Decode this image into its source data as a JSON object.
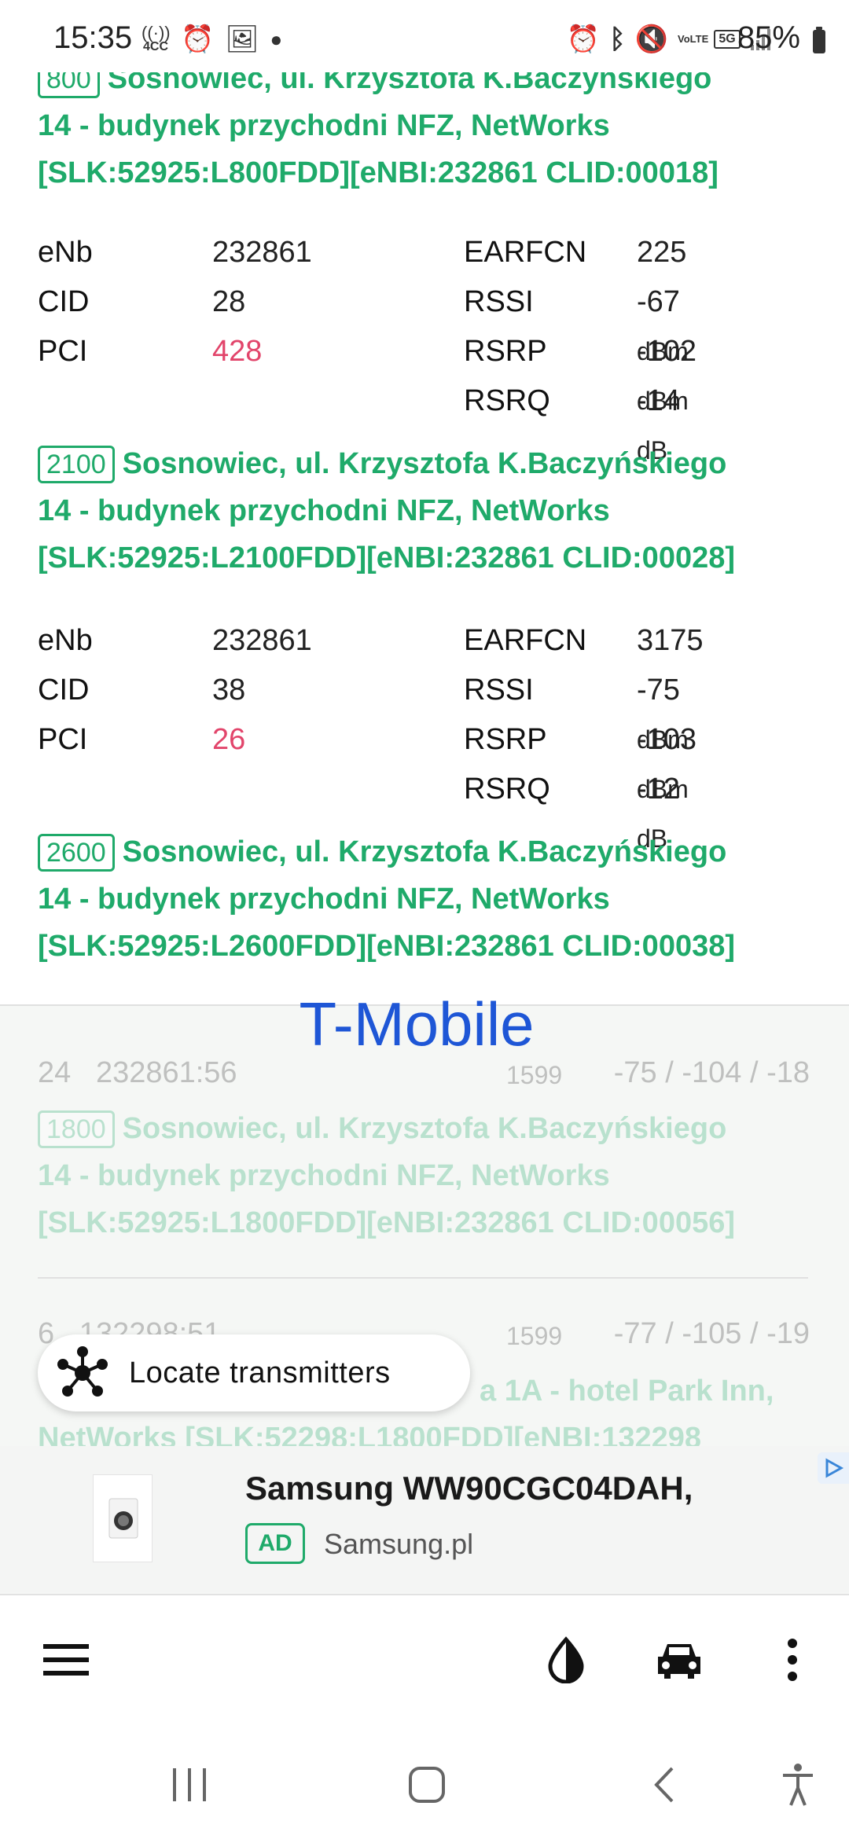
{
  "status_bar": {
    "time": "15:35",
    "left_icons": [
      "4cc-icon",
      "alarm-icon",
      "image-icon",
      "dot-icon"
    ],
    "right_icons": [
      "alarm-icon",
      "bluetooth-icon",
      "mute-icon",
      "volte-icon",
      "5g-icon",
      "signal-icon"
    ],
    "badge_4cc": "4CC",
    "badge_volte": "VoLTE",
    "badge_5g": "5G",
    "battery": "85%"
  },
  "top_cell": {
    "band": "800",
    "line1": "Sosnowiec, ul. Krzysztofa K.Baczyńskiego",
    "line2": "14 - budynek przychodni NFZ, NetWorks",
    "line3": "[SLK:52925:L800FDD][eNBI:232861 CLID:00018]"
  },
  "cells": [
    {
      "labels": {
        "enb": "eNb",
        "cid": "CID",
        "pci": "PCI",
        "earfcn": "EARFCN",
        "rssi": "RSSI",
        "rsrp": "RSRP",
        "rsrq": "RSRQ"
      },
      "enb": "232861",
      "cid": "28",
      "pci": "428",
      "earfcn": "225",
      "rssi": "-67",
      "rssi_unit": "dBm",
      "rsrp": "-102",
      "rsrp_unit": "dBm",
      "rsrq": "-14",
      "rsrq_unit": "dB",
      "band": "2100",
      "line1": "Sosnowiec, ul. Krzysztofa K.Baczyńskiego",
      "line2": "14 - budynek przychodni NFZ, NetWorks",
      "line3": "[SLK:52925:L2100FDD][eNBI:232861 CLID:00028]"
    },
    {
      "labels": {
        "enb": "eNb",
        "cid": "CID",
        "pci": "PCI",
        "earfcn": "EARFCN",
        "rssi": "RSSI",
        "rsrp": "RSRP",
        "rsrq": "RSRQ"
      },
      "enb": "232861",
      "cid": "38",
      "pci": "26",
      "earfcn": "3175",
      "rssi": "-75",
      "rssi_unit": "dBm",
      "rsrp": "-103",
      "rsrp_unit": "dBm",
      "rsrq": "-12",
      "rsrq_unit": "dB",
      "band": "2600",
      "line1": "Sosnowiec, ul. Krzysztofa K.Baczyńskiego",
      "line2": "14 - budynek przychodni NFZ, NetWorks",
      "line3": "[SLK:52925:L2600FDD][eNBI:232861 CLID:00038]"
    }
  ],
  "operator": {
    "name": "T-Mobile",
    "neighbors": [
      {
        "left": "24   232861:56",
        "earfcn": "1599",
        "signal": "-75 / -104 / -18",
        "band": "1800",
        "line1": "Sosnowiec, ul. Krzysztofa K.Baczyńskiego",
        "line2": "14 - budynek przychodni NFZ, NetWorks",
        "line3": "[SLK:52925:L1800FDD][eNBI:232861 CLID:00056]"
      },
      {
        "left": "6   132298:51",
        "earfcn": "1599",
        "signal": "-77 / -105 / -19",
        "line1_partial": "a 1A - hotel Park Inn,",
        "line2_partial": "NetWorks [SLK:52298:L1800FDD][eNBI:132298"
      }
    ]
  },
  "locate_button": {
    "label": "Locate transmitters",
    "icon": "transmitters-icon"
  },
  "ad": {
    "title": "Samsung WW90CGC04DAH,",
    "badge": "AD",
    "source": "Samsung.pl"
  },
  "toolbar": {
    "icons": [
      "menu-icon",
      "theme-icon",
      "car-icon",
      "more-icon"
    ]
  },
  "navbar": {
    "icons": [
      "recents-icon",
      "home-icon",
      "back-icon",
      "accessibility-icon"
    ]
  },
  "colors": {
    "site_green": "#1faa6a",
    "pci_pink": "#e2456b",
    "operator_blue": "#1e56d6"
  }
}
